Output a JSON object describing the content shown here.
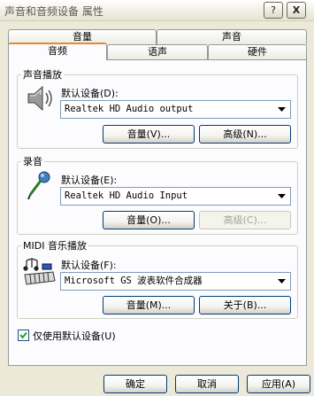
{
  "window": {
    "title": "声音和音频设备 属性",
    "help": "?",
    "close": "X"
  },
  "tabs": {
    "row_back": [
      "音量",
      "声音"
    ],
    "row_front": [
      "音频",
      "语声",
      "硬件"
    ]
  },
  "playback": {
    "legend": "声音播放",
    "default_label": "默认设备(D):",
    "device": "Realtek HD Audio output",
    "volume_btn": "音量(V)...",
    "advanced_btn": "高级(N)..."
  },
  "recording": {
    "legend": "录音",
    "default_label": "默认设备(E):",
    "device": "Realtek HD Audio Input",
    "volume_btn": "音量(O)...",
    "advanced_btn": "高级(C)..."
  },
  "midi": {
    "legend": "MIDI 音乐播放",
    "default_label": "默认设备(F):",
    "device": "Microsoft GS 波表软件合成器",
    "volume_btn": "音量(M)...",
    "about_btn": "关于(B)..."
  },
  "only_default": {
    "label": "仅使用默认设备(U)",
    "checked": true
  },
  "footer": {
    "ok": "确定",
    "cancel": "取消",
    "apply": "应用(A)"
  },
  "colors": {
    "dialog_bg": "#ece9d8",
    "panel_bg": "#fcfcfe",
    "tab_highlight": "#e68b2c",
    "button_border": "#003c74"
  }
}
